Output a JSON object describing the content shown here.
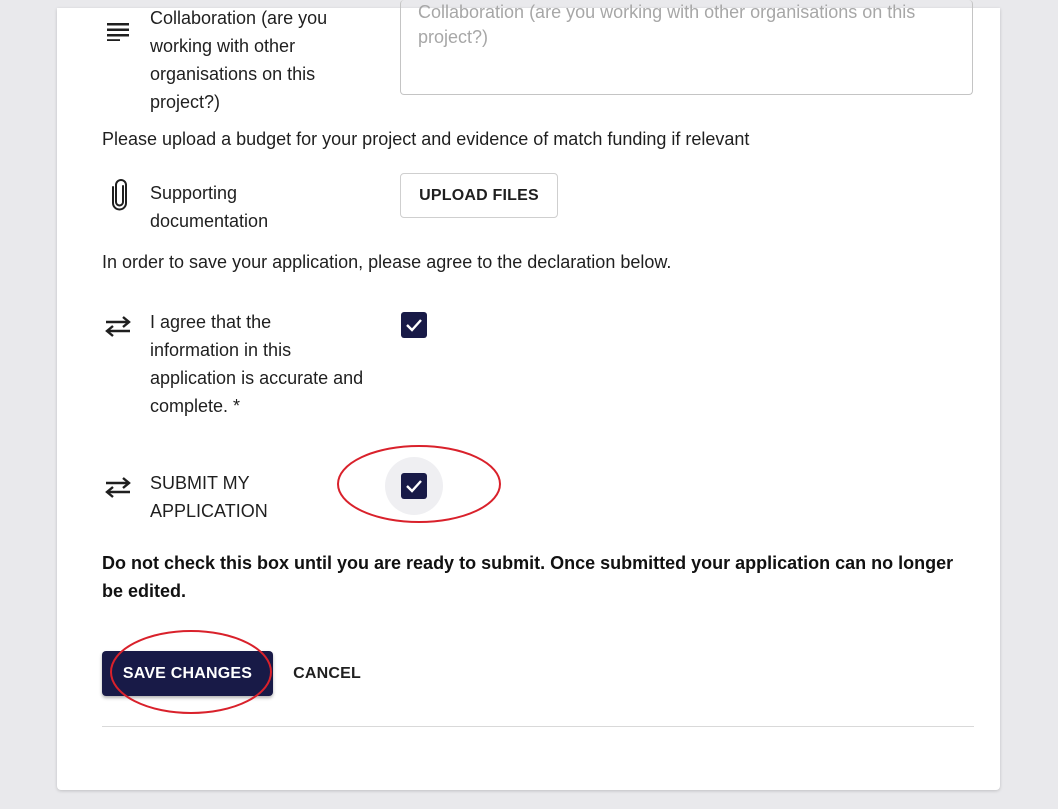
{
  "collaboration": {
    "label": "Collaboration (are you working with other organisations on this project?)",
    "placeholder": "Collaboration (are you working with other organisations on this project?)",
    "icon": "text-lines-icon"
  },
  "budget_instruction": "Please upload a budget for your project and evidence of match funding if relevant",
  "supporting_docs": {
    "label": "Supporting documentation",
    "button_label": "UPLOAD FILES",
    "icon": "paperclip-icon"
  },
  "declaration_instruction": "In order to save your application, please agree to the declaration below.",
  "agree": {
    "label": "I agree that the information in this application is accurate and complete. *",
    "checked": true,
    "icon": "swap-arrows-icon"
  },
  "submit": {
    "label": "SUBMIT MY APPLICATION",
    "checked": true,
    "icon": "swap-arrows-icon"
  },
  "warning": "Do not check this box until you are ready to submit. Once submitted your application can no longer be edited.",
  "actions": {
    "save_label": "SAVE CHANGES",
    "cancel_label": "CANCEL"
  },
  "colors": {
    "primary": "#181a47",
    "annotation": "#d9212b",
    "background": "#e9e9ec"
  }
}
